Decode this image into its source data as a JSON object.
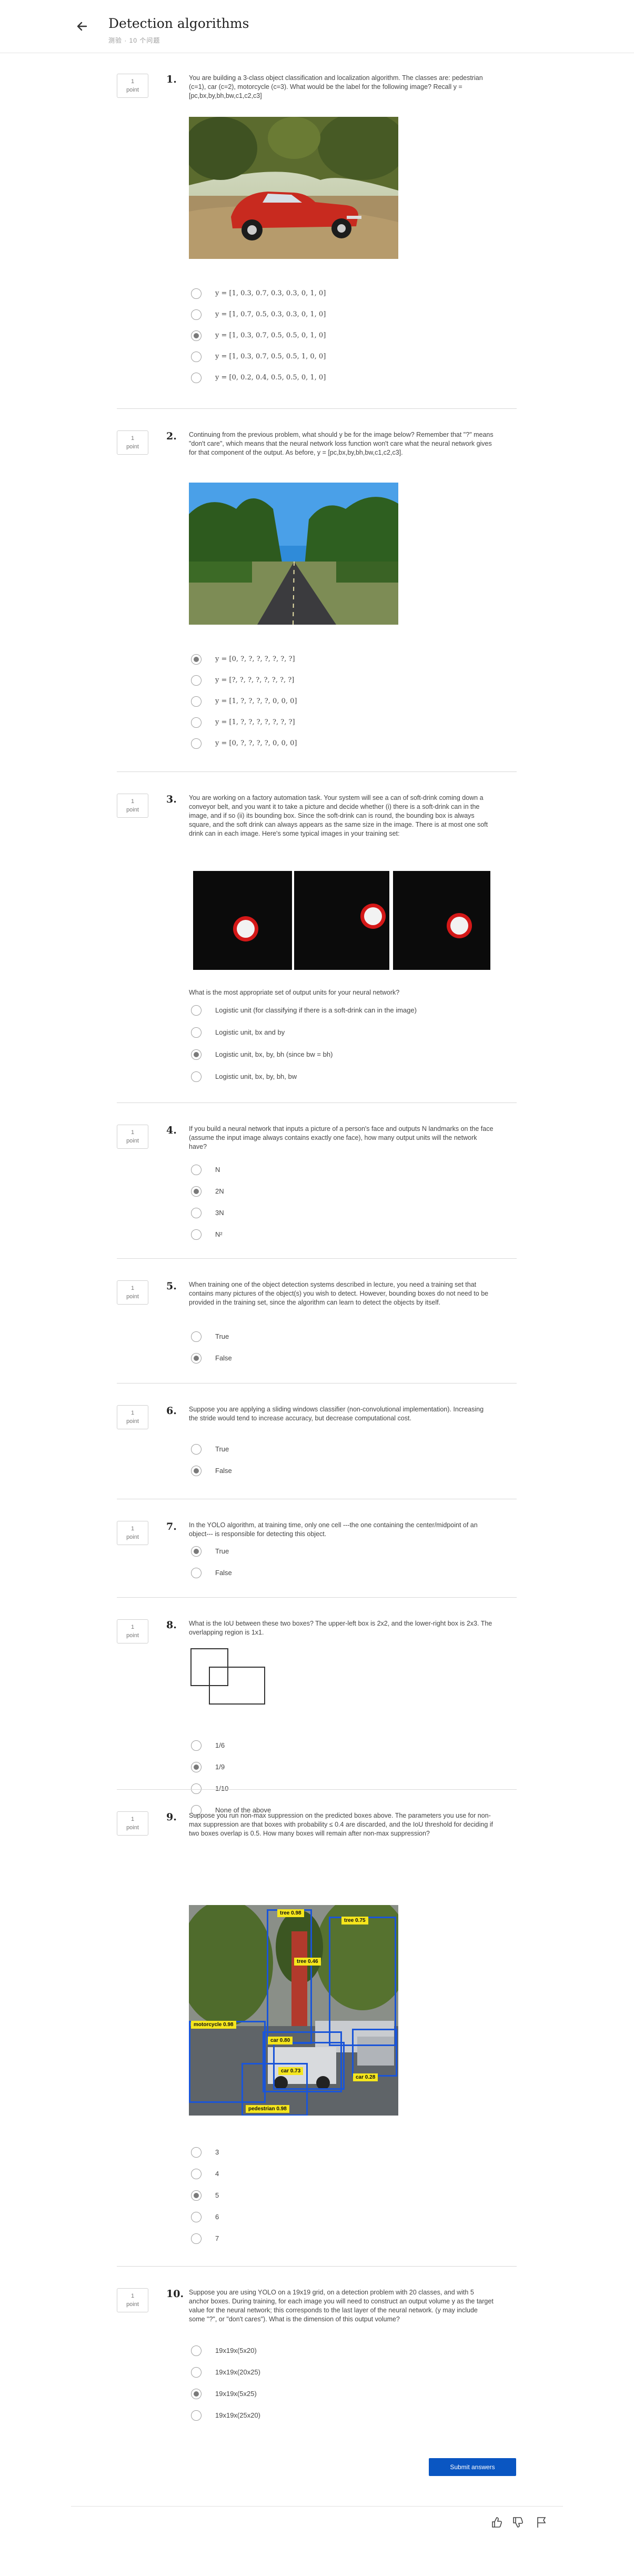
{
  "header": {
    "title": "Detection algorithms",
    "subtitle": "测验 · 10 个问题"
  },
  "points_label": "1\npoint",
  "questions": [
    {
      "number": "1.",
      "prompt": "You are building a 3-class object classification and localization algorithm. The classes are: pedestrian (c=1), car (c=2), motorcycle (c=3). What would be the label for the following image? Recall y = [pc,bx,by,bh,bw,c1,c2,c3]",
      "image": "red-vintage-car-on-dirt-road",
      "options": [
        "y = [1, 0.3, 0.7, 0.3, 0.3, 0, 1, 0]",
        "y = [1, 0.7, 0.5, 0.3, 0.3, 0, 1, 0]",
        "y = [1, 0.3, 0.7, 0.5, 0.5, 0, 1, 0]",
        "y = [1, 0.3, 0.7, 0.5, 0.5, 1, 0, 0]",
        "y = [0, 0.2, 0.4, 0.5, 0.5, 0, 1, 0]"
      ],
      "selected": 2
    },
    {
      "number": "2.",
      "prompt": "Continuing from the previous problem, what should y be for the image below? Remember that \"?\" means \"don't care\", which means that the neural network loss function won't care what the neural network gives for that component of the output. As before, y = [pc,bx,by,bh,bw,c1,c2,c3].",
      "image": "empty-tree-lined-road",
      "options": [
        "y = [0, ?, ?, ?, ?, ?, ?, ?]",
        "y = [?, ?, ?, ?, ?, ?, ?, ?]",
        "y = [1, ?, ?, ?, ?, 0, 0, 0]",
        "y = [1, ?, ?, ?, ?, ?, ?, ?]",
        "y = [0, ?, ?, ?, ?, 0, 0, 0]"
      ],
      "selected": 0
    },
    {
      "number": "3.",
      "prompt": "You are working on a factory automation task. Your system will see a can of soft-drink coming down a conveyor belt, and you want it to take a picture and decide whether (i) there is a soft-drink can in the image, and if so (ii) its bounding box. Since the soft-drink can is round, the bounding box is always square, and the soft drink can always appears as the same size in the image. There is at most one soft drink can in each image. Here's some typical images in your training set:",
      "subprompt": "What is the most appropriate set of output units for your neural network?",
      "options": [
        "Logistic unit (for classifying if there is a soft-drink can in the image)",
        "Logistic unit, bx and by",
        "Logistic unit, bx, by, bh (since bw = bh)",
        "Logistic unit, bx, by, bh, bw"
      ],
      "selected": 2
    },
    {
      "number": "4.",
      "prompt": "If you build a neural network that inputs a picture of a person's face and outputs N landmarks on the face (assume the input image always contains exactly one face), how many output units will the network have?",
      "options": [
        "N",
        "2N",
        "3N",
        "N²"
      ],
      "selected": 1
    },
    {
      "number": "5.",
      "prompt": "When training one of the object detection systems described in lecture, you need a training set that contains many pictures of the object(s) you wish to detect. However, bounding boxes do not need to be provided in the training set, since the algorithm can learn to detect the objects by itself.",
      "options": [
        "True",
        "False"
      ],
      "selected": 1
    },
    {
      "number": "6.",
      "prompt": "Suppose you are applying a sliding windows classifier (non-convolutional implementation). Increasing the stride would tend to increase accuracy, but decrease computational cost.",
      "options": [
        "True",
        "False"
      ],
      "selected": 1
    },
    {
      "number": "7.",
      "prompt": "In the YOLO algorithm, at training time, only one cell ---the one containing the center/midpoint of an object--- is responsible for detecting this object.",
      "options": [
        "True",
        "False"
      ],
      "selected": 0
    },
    {
      "number": "8.",
      "prompt": "What is the IoU between these two boxes? The upper-left box is 2x2, and the lower-right box is 2x3. The overlapping region is 1x1.",
      "options": [
        "1/6",
        "1/9",
        "1/10",
        "None of the above"
      ],
      "selected": 1
    },
    {
      "number": "9.",
      "prompt": "Suppose you run non-max suppression on the predicted boxes above. The parameters you use for non-max suppression are that boxes with probability ≤ 0.4 are discarded, and the IoU threshold for deciding if two boxes overlap is 0.5. How many boxes will remain after non-max suppression?",
      "image": "street-scene-with-detection-boxes",
      "box_labels": [
        "tree 0.98",
        "tree 0.75",
        "car 0.80",
        "motorcycle 0.98",
        "car 0.73",
        "car 0.28",
        "pedestrian 0.98",
        "tree 0.46"
      ],
      "options": [
        "3",
        "4",
        "5",
        "6",
        "7"
      ],
      "selected": 2
    },
    {
      "number": "10.",
      "prompt": "Suppose you are using YOLO on a 19x19 grid, on a detection problem with 20 classes, and with 5 anchor boxes. During training, for each image you will need to construct an output volume y as the target value for the neural network; this corresponds to the last layer of the neural network. (y may include some \"?\", or \"don't cares\"). What is the dimension of this output volume?",
      "options": [
        "19x19x(5x20)",
        "19x19x(20x25)",
        "19x19x(5x25)",
        "19x19x(25x20)"
      ],
      "selected": 2
    }
  ],
  "submit_label": "Submit answers",
  "footer_icons": [
    "thumbs-up-icon",
    "thumbs-down-icon",
    "flag-icon"
  ]
}
